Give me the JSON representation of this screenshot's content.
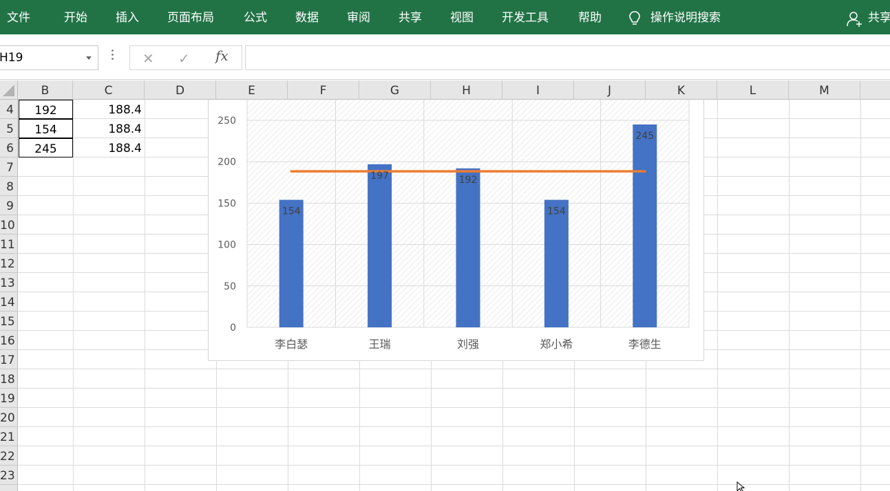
{
  "menu": {
    "items": [
      "文件",
      "开始",
      "插入",
      "页面布局",
      "公式",
      "数据",
      "审阅",
      "共享",
      "视图",
      "开发工具",
      "帮助"
    ],
    "tell_me": "操作说明搜索",
    "share": "共享"
  },
  "formula_bar": {
    "name_box": "H19",
    "cancel": "✕",
    "enter": "✓",
    "fx": "fx",
    "formula": ""
  },
  "columns": [
    "B",
    "C",
    "D",
    "E",
    "F",
    "G",
    "H",
    "I",
    "J",
    "K",
    "L",
    "M"
  ],
  "rows": [
    "4",
    "5",
    "6",
    "7",
    "8",
    "9",
    "10",
    "11",
    "12",
    "13",
    "14",
    "15",
    "16",
    "17",
    "18",
    "19",
    "20",
    "21",
    "22",
    "23"
  ],
  "cells": [
    {
      "b": "192",
      "c": "188.4"
    },
    {
      "b": "154",
      "c": "188.4"
    },
    {
      "b": "245",
      "c": "188.4"
    }
  ],
  "colors": {
    "ribbon": "#217346",
    "bar": "#4472C4",
    "line": "#ED7D31"
  },
  "chart_data": {
    "type": "bar",
    "categories": [
      "李白瑟",
      "王瑞",
      "刘强",
      "郑小希",
      "李德生"
    ],
    "series": [
      {
        "type": "bar",
        "values": [
          154,
          197,
          192,
          154,
          245
        ],
        "data_labels": [
          "154",
          "197",
          "192",
          "154",
          "245"
        ]
      },
      {
        "type": "line",
        "values": [
          188.4,
          188.4,
          188.4,
          188.4,
          188.4
        ]
      }
    ],
    "y_ticks": [
      "0",
      "50",
      "100",
      "150",
      "200",
      "250"
    ],
    "ylim": [
      0,
      250
    ],
    "grid": true,
    "legend": "none"
  }
}
